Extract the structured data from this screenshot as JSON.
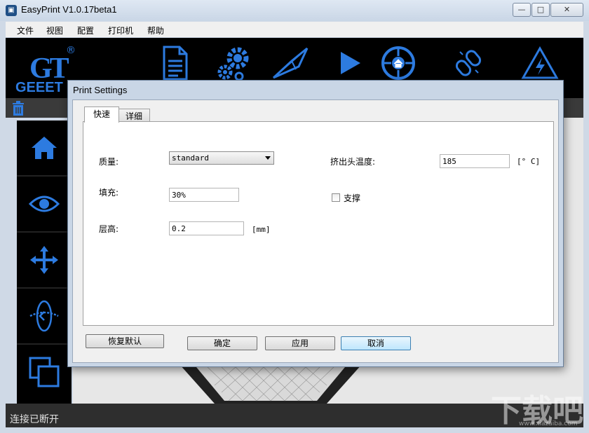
{
  "window": {
    "title": "EasyPrint   V1.0.17beta1",
    "controls": {
      "minimize": "—",
      "maximize": "□",
      "close": "✕"
    }
  },
  "menu": [
    "文件",
    "视图",
    "配置",
    "打印机",
    "帮助"
  ],
  "toolbar": {
    "logo_text": "GEEET",
    "logo_mark": "GT",
    "logo_reg": "®",
    "icons": [
      "document-icon",
      "gears-icon",
      "slice-icon",
      "play-icon",
      "home-target-icon",
      "link-icon",
      "warning-bolt-icon"
    ]
  },
  "sidebar": {
    "icons": [
      "home-icon",
      "eye-icon",
      "move-icon",
      "rotate-icon",
      "copy-icon"
    ]
  },
  "status": {
    "text": "连接已断开"
  },
  "watermark": {
    "text": "下载吧",
    "sub": "www.xiazaiba.com"
  },
  "dialog": {
    "title": "Print Settings",
    "tabs": [
      {
        "label": "快速",
        "active": true
      },
      {
        "label": "详细",
        "active": false
      }
    ],
    "fields": {
      "quality": {
        "label": "质量:",
        "value": "standard"
      },
      "infill": {
        "label": "填充:",
        "value": "30%"
      },
      "layer_height": {
        "label": "层高:",
        "value": "0.2",
        "unit": "[mm]"
      },
      "extruder_temp": {
        "label": "挤出头温度:",
        "value": "185",
        "unit": "[° C]"
      },
      "support": {
        "label": "支撑",
        "checked": false
      }
    },
    "buttons": {
      "restore_default": "恢复默认",
      "ok": "确定",
      "apply": "应用",
      "cancel": "取消"
    }
  },
  "colors": {
    "accent": "#2d7be0",
    "toolbar_bg": "#000000",
    "dialog_frame": "#c9d6e6"
  }
}
